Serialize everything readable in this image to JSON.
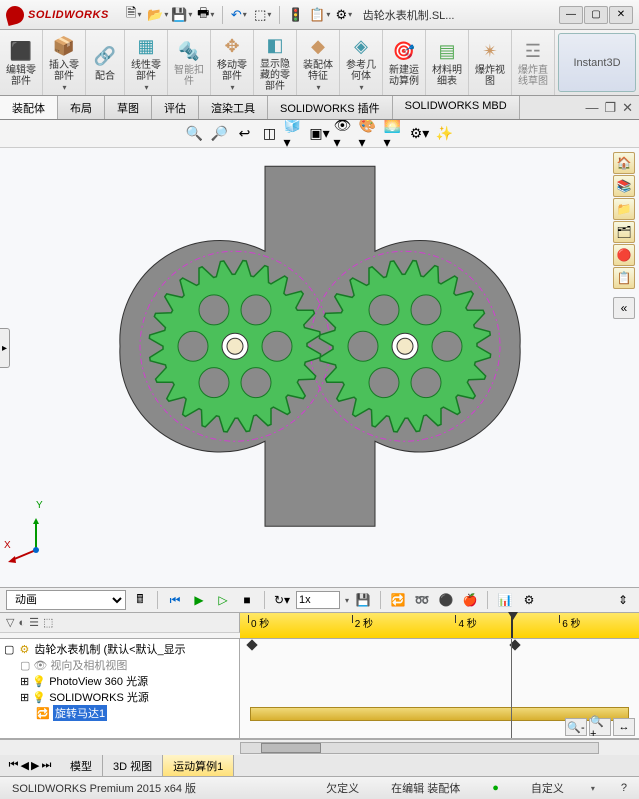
{
  "title": {
    "app": "SOLIDWORKS",
    "doc": "齿轮水表机制.SL..."
  },
  "qat_icons": [
    "new",
    "open",
    "save",
    "print",
    "undo",
    "redo",
    "select",
    "rebuild",
    "options",
    "settings"
  ],
  "ribbon": [
    {
      "id": "edit-part",
      "label": "编辑零\n部件",
      "icon": "✎",
      "color": "#c96"
    },
    {
      "id": "insert-part",
      "label": "插入零\n部件",
      "icon": "⬚",
      "color": "#c96"
    },
    {
      "id": "mate",
      "label": "配合",
      "icon": "🛠",
      "color": "#888"
    },
    {
      "id": "linear-pattern",
      "label": "线性零\n部件",
      "icon": "▦",
      "color": "#39a"
    },
    {
      "id": "smart-fasteners",
      "label": "智能扣\n件",
      "icon": "⚙",
      "color": "#888",
      "disabled": true
    },
    {
      "id": "move-comp",
      "label": "移动零\n部件",
      "icon": "✥",
      "color": "#c96"
    },
    {
      "id": "show-hide",
      "label": "显示隐\n藏的零\n部件",
      "icon": "◧",
      "color": "#49a"
    },
    {
      "id": "assy-feat",
      "label": "装配体\n特征",
      "icon": "◆",
      "color": "#c96"
    },
    {
      "id": "ref-geom",
      "label": "参考几\n何体",
      "icon": "◇",
      "color": "#49a"
    },
    {
      "id": "new-motion",
      "label": "新建运\n动算例",
      "icon": "▶",
      "color": "#c96"
    },
    {
      "id": "bom",
      "label": "材料明\n细表",
      "icon": "▤",
      "color": "#5a5"
    },
    {
      "id": "exploded",
      "label": "爆炸视\n图",
      "icon": "✷",
      "color": "#c96"
    },
    {
      "id": "explode-line",
      "label": "爆炸直\n线草图",
      "icon": "☲",
      "color": "#888",
      "disabled": true
    }
  ],
  "instant3d": "Instant3D",
  "doctabs": [
    "装配体",
    "布局",
    "草图",
    "评估",
    "渲染工具",
    "SOLIDWORKS 插件",
    "SOLIDWORKS MBD"
  ],
  "triad": {
    "x": "X",
    "y": "Y"
  },
  "motion": {
    "type_label": "动画",
    "speed": "1x",
    "ticks": [
      "0 秒",
      "2 秒",
      "4 秒",
      "6 秒"
    ],
    "tree": [
      {
        "lvl": 0,
        "icon": "⚙",
        "text": "齿轮水表机制 (默认<默认_显示"
      },
      {
        "lvl": 1,
        "icon": "👁",
        "text": "视向及相机视图",
        "muted": true
      },
      {
        "lvl": 1,
        "icon": "💡",
        "text": "PhotoView 360 光源"
      },
      {
        "lvl": 1,
        "icon": "💡",
        "text": "SOLIDWORKS 光源"
      },
      {
        "lvl": 1,
        "icon": "🔁",
        "text": "旋转马达1",
        "sel": true
      }
    ]
  },
  "bottom_tabs": [
    "模型",
    "3D 视图",
    "运动算例1"
  ],
  "status": {
    "product": "SOLIDWORKS Premium 2015 x64 版",
    "defn": "欠定义",
    "context": "在编辑 装配体",
    "custom": "自定义"
  }
}
